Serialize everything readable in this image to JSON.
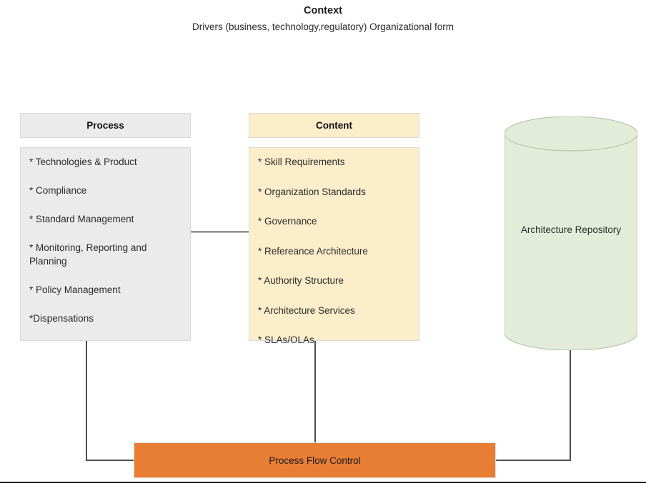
{
  "diagram": {
    "title": "Context",
    "subtitle": "Drivers (business, technology,regulatory) Organizational form"
  },
  "columns": {
    "process": {
      "header": "Process",
      "items": [
        "* Technologies & Product",
        "* Compliance",
        "* Standard Management",
        "* Monitoring, Reporting and Planning",
        "* Policy Management",
        "*Dispensations"
      ]
    },
    "content": {
      "header": "Content",
      "items": [
        "* Skill Requirements",
        "* Organization Standards",
        "* Governance",
        "* Refereance Architecture",
        "* Authority Structure",
        "* Architecture Services",
        "* SLAs/OLAs"
      ]
    }
  },
  "repository": {
    "label": "Architecture Repository"
  },
  "flow_control": {
    "label": "Process Flow Control"
  },
  "colors": {
    "process_fill": "#ebebeb",
    "content_fill": "#fceecb",
    "repository_fill": "#e2ecd8",
    "repository_stroke": "#b7c6ab",
    "flow_control_fill": "#e87d34",
    "connector_stroke": "#3a3a3a",
    "box_border": "#d9d9d9"
  }
}
